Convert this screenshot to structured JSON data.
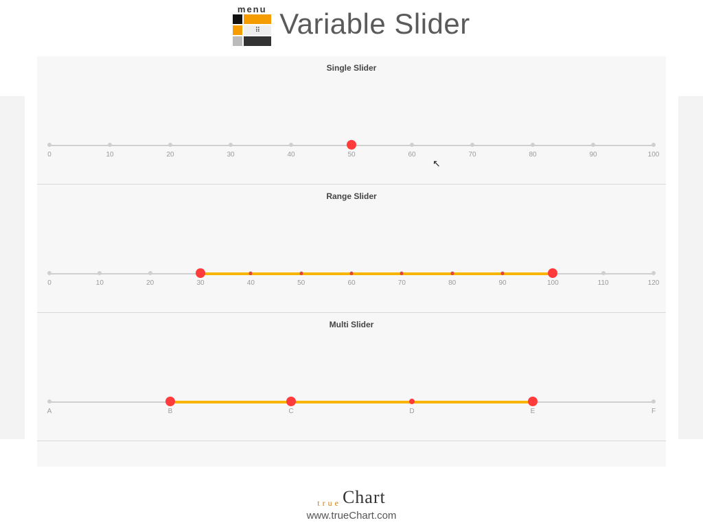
{
  "header": {
    "menu_label": "menu",
    "title": "Variable Slider"
  },
  "sliders": [
    {
      "title": "Single Slider",
      "min": 0,
      "max": 100,
      "step": 10,
      "ticks": [
        0,
        10,
        20,
        30,
        40,
        50,
        60,
        70,
        80,
        90,
        100
      ],
      "handles": [
        50
      ],
      "fill": null,
      "inner_ticks": []
    },
    {
      "title": "Range Slider",
      "min": 0,
      "max": 120,
      "step": 10,
      "ticks": [
        0,
        10,
        20,
        30,
        40,
        50,
        60,
        70,
        80,
        90,
        100,
        110,
        120
      ],
      "handles": [
        30,
        100
      ],
      "fill": [
        30,
        100
      ],
      "inner_ticks": [
        40,
        50,
        60,
        70,
        80,
        90
      ]
    },
    {
      "title": "Multi Slider",
      "min": 0,
      "max": 5,
      "step": 1,
      "ticks": [
        "A",
        "B",
        "C",
        "D",
        "E",
        "F"
      ],
      "tick_positions": [
        0,
        1,
        2,
        3,
        4,
        5
      ],
      "handles": [
        1,
        2,
        3,
        4
      ],
      "handle_sizes": [
        "big",
        "big",
        "small",
        "big"
      ],
      "fill": [
        1,
        4
      ],
      "inner_ticks": []
    }
  ],
  "footer": {
    "brand_true": "true",
    "brand_chart": "Chart",
    "url": "www.trueChart.com"
  }
}
